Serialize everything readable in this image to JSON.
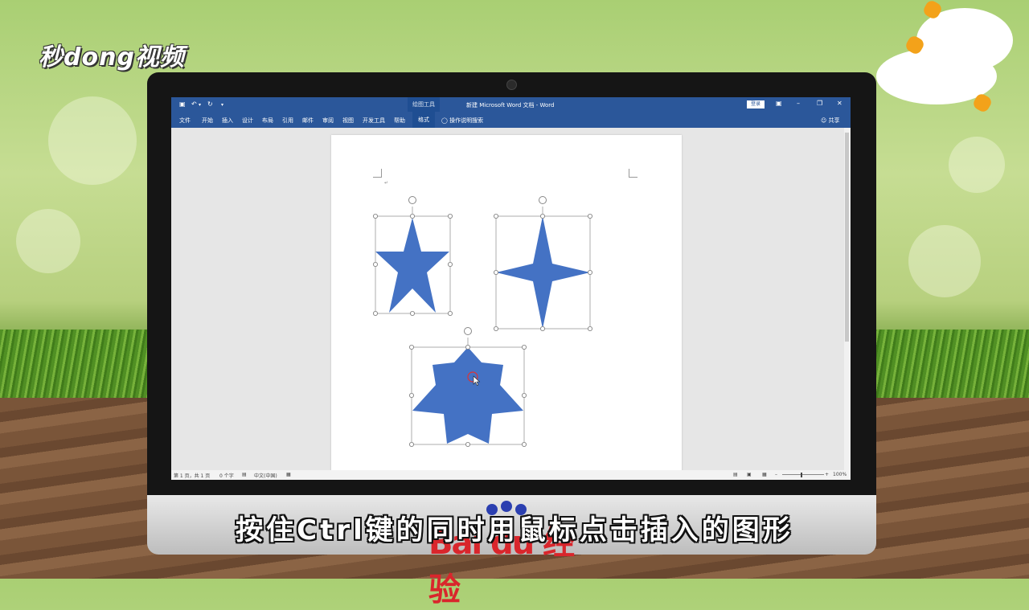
{
  "brand": {
    "logo_text": "秒dong视频"
  },
  "word": {
    "title": "新建 Microsoft Word 文档 - Word",
    "context_tab_group": "绘图工具",
    "login_label": "登录",
    "quick_access": {
      "save_icon": "save-icon",
      "undo_icon": "undo-icon",
      "redo_icon": "redo-icon",
      "customize_icon": "chevron-down-icon"
    },
    "window_controls": [
      "ribbon-display-icon",
      "minimize-icon",
      "restore-icon",
      "close-icon"
    ],
    "ribbon_tabs": [
      {
        "label": "文件"
      },
      {
        "label": "开始"
      },
      {
        "label": "插入"
      },
      {
        "label": "设计"
      },
      {
        "label": "布局"
      },
      {
        "label": "引用"
      },
      {
        "label": "邮件"
      },
      {
        "label": "审阅"
      },
      {
        "label": "视图"
      },
      {
        "label": "开发工具"
      },
      {
        "label": "帮助"
      },
      {
        "label": "格式",
        "active": true
      }
    ],
    "tell_me": "操作说明搜索",
    "share": "共享",
    "status": {
      "page": "第 1 页，共 1 页",
      "words": "0 个字",
      "language": "中文(中国)",
      "zoom": "100%"
    }
  },
  "shapes": [
    {
      "name": "five-point-star",
      "selected": true,
      "fill": "#4472c4"
    },
    {
      "name": "four-point-star",
      "selected": true,
      "fill": "#4472c4"
    },
    {
      "name": "seven-point-star",
      "selected": true,
      "fill": "#4472c4"
    }
  ],
  "caption": "按住Ctrl键的同时用鼠标点击插入的图形",
  "colors": {
    "word_blue": "#2b579a",
    "shape_fill": "#4472c4",
    "baidu_red": "#d9262c",
    "baidu_blue": "#2b3fb0"
  },
  "watermark": {
    "text": "Bai du 经验"
  }
}
